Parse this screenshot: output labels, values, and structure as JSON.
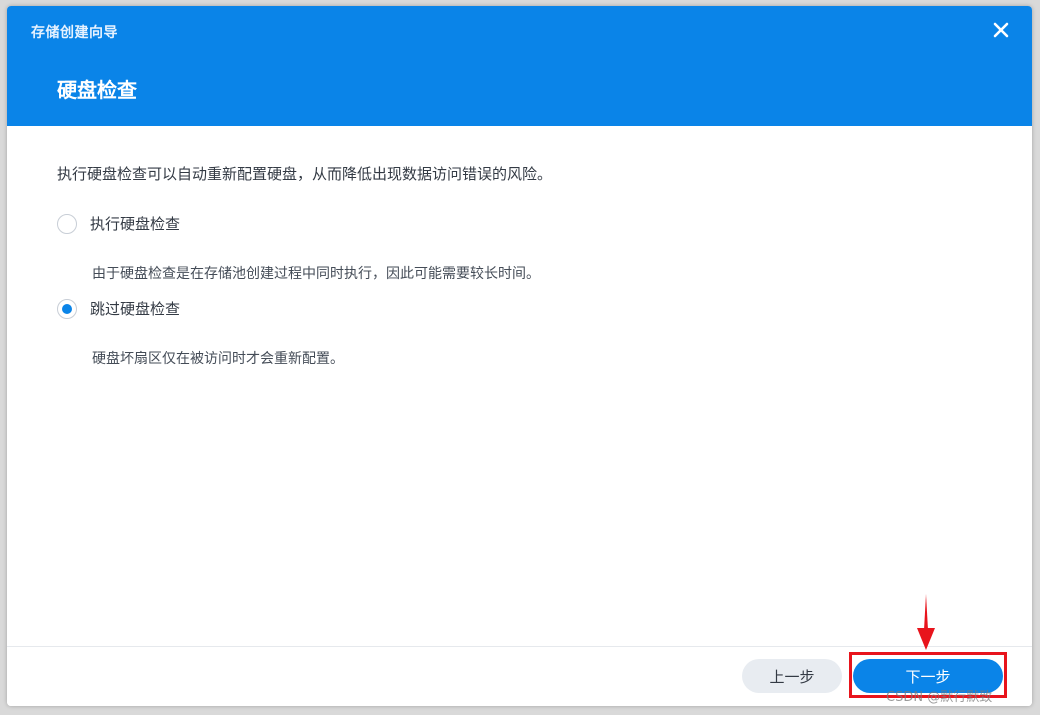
{
  "window": {
    "title": "存储创建向导",
    "close_icon": "close-icon"
  },
  "step": {
    "title": "硬盘检查"
  },
  "intro": "执行硬盘检查可以自动重新配置硬盘，从而降低出现数据访问错误的风险。",
  "options": [
    {
      "label": "执行硬盘检查",
      "description": "由于硬盘检查是在存储池创建过程中同时执行，因此可能需要较长时间。",
      "checked": false
    },
    {
      "label": "跳过硬盘检查",
      "description": "硬盘坏扇区仅在被访问时才会重新配置。",
      "checked": true
    }
  ],
  "footer": {
    "prev_label": "上一步",
    "next_label": "下一步"
  },
  "watermark": "CSDN @默行默致",
  "colors": {
    "accent": "#0a84e8",
    "highlight": "#e8141c"
  }
}
